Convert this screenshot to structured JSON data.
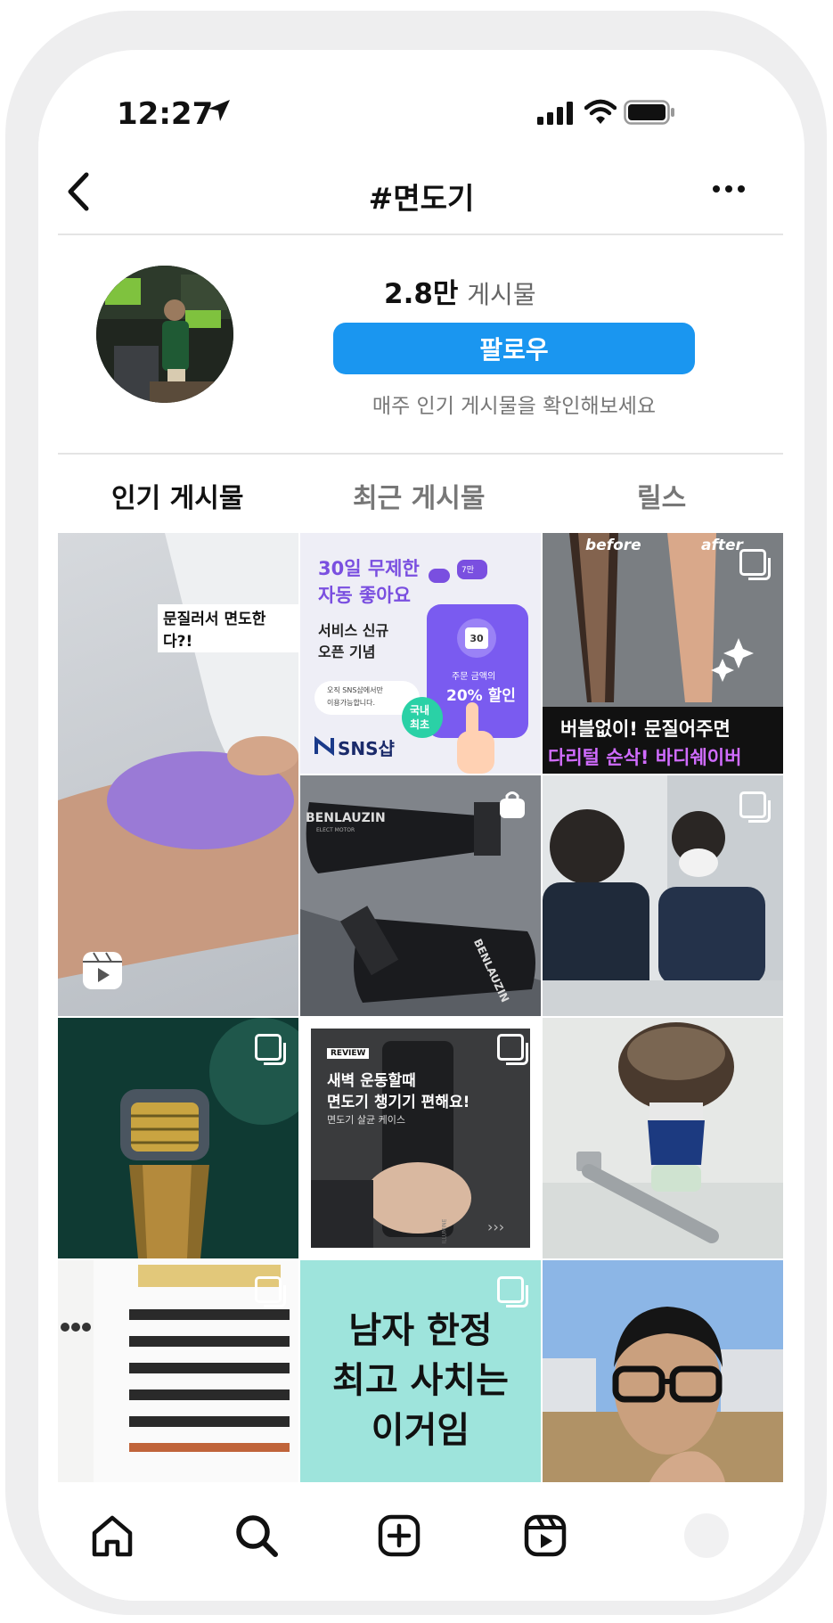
{
  "status_bar": {
    "time": "12:27"
  },
  "nav": {
    "title": "#면도기"
  },
  "header": {
    "post_count": "2.8만",
    "post_label": "게시물",
    "follow_label": "팔로우",
    "weekly_text": "매주 인기 게시물을 확인해보세요"
  },
  "tabs": [
    {
      "label": "인기 게시물",
      "active": true
    },
    {
      "label": "최근 게시물",
      "active": false
    },
    {
      "label": "릴스",
      "active": false
    }
  ],
  "grid": {
    "t1_caption": "문질러서 면도한다?!",
    "t2_headline_1": "30일 무제한",
    "t2_headline_2": "자동 좋아요",
    "t2_sub_1": "서비스 신규",
    "t2_sub_2": "오픈 기념",
    "t2_note_1": "오직 SNS샵에서만",
    "t2_note_2": "이용가능합니다.",
    "t2_badge_1": "국내",
    "t2_badge_2": "최초",
    "t2_calendar": "30",
    "t2_discount_1": "주문 금액의",
    "t2_discount_2": "20% 할인",
    "t2_heart_count": "7만",
    "t2_brand": "SNS샵",
    "t3_before": "before",
    "t3_after": "after",
    "t3_line1": "버블없이! 문질어주면",
    "t3_line2": "다리털 순삭! 바디쉐이버",
    "t4_brand": "BENLAUZIN",
    "t4_brand_sub": "ELECT MOTOR",
    "t4_brand_2": "BENLAUZIN",
    "t8_review": "REVIEW",
    "t8_line1": "새벽 운동할때",
    "t8_line2": "면도기 챙기기 편해요!",
    "t8_line3": "면도기 살균 케이스",
    "t8_case_brand": "ILLUMINE",
    "t11_line1": "남자 한정",
    "t11_line2": "최고 사치는",
    "t11_line3": "이거임"
  },
  "colors": {
    "accent_blue": "#1a96f0",
    "promo_purple": "#7a4fe0",
    "mint": "#9ee4dc",
    "dark_green": "#123b34"
  },
  "bottom_nav": [
    "home-icon",
    "search-icon",
    "create-icon",
    "reels-icon",
    "profile-avatar"
  ]
}
